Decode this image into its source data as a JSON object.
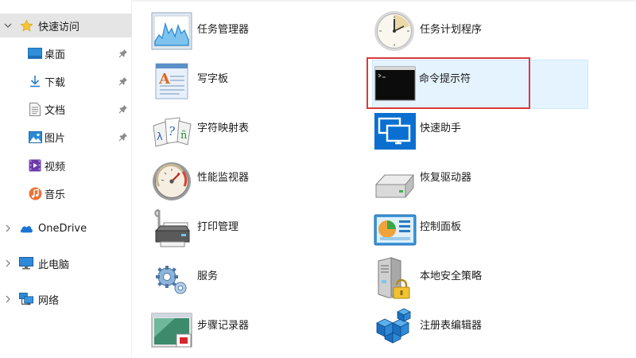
{
  "nav": {
    "quick_access": {
      "label": "快速访问",
      "items": [
        {
          "label": "桌面",
          "icon": "desktop-icon"
        },
        {
          "label": "下载",
          "icon": "download-icon"
        },
        {
          "label": "文档",
          "icon": "document-icon"
        },
        {
          "label": "图片",
          "icon": "pictures-icon"
        },
        {
          "label": "视频",
          "icon": "videos-icon"
        },
        {
          "label": "音乐",
          "icon": "music-icon"
        }
      ]
    },
    "onedrive": {
      "label": "OneDrive",
      "icon": "cloud-icon"
    },
    "this_pc": {
      "label": "此电脑",
      "icon": "computer-icon"
    },
    "network": {
      "label": "网络",
      "icon": "network-icon"
    }
  },
  "tools": [
    {
      "label": "任务管理器",
      "icon": "task-manager-icon"
    },
    {
      "label": "任务计划程序",
      "icon": "task-scheduler-icon"
    },
    {
      "label": "写字板",
      "icon": "wordpad-icon"
    },
    {
      "label": "命令提示符",
      "icon": "command-prompt-icon"
    },
    {
      "label": "字符映射表",
      "icon": "character-map-icon"
    },
    {
      "label": "快速助手",
      "icon": "quick-assist-icon"
    },
    {
      "label": "性能监视器",
      "icon": "performance-monitor-icon"
    },
    {
      "label": "恢复驱动器",
      "icon": "recovery-drive-icon"
    },
    {
      "label": "打印管理",
      "icon": "print-management-icon"
    },
    {
      "label": "控制面板",
      "icon": "control-panel-icon"
    },
    {
      "label": "服务",
      "icon": "services-icon"
    },
    {
      "label": "本地安全策略",
      "icon": "local-security-policy-icon"
    },
    {
      "label": "步骤记录器",
      "icon": "steps-recorder-icon"
    },
    {
      "label": "注册表编辑器",
      "icon": "registry-editor-icon"
    }
  ],
  "colors": {
    "selection": "#e5e5e5",
    "hover": "#e5f3ff",
    "highlight_border": "#d93a3a",
    "accent": "#0078d7"
  }
}
